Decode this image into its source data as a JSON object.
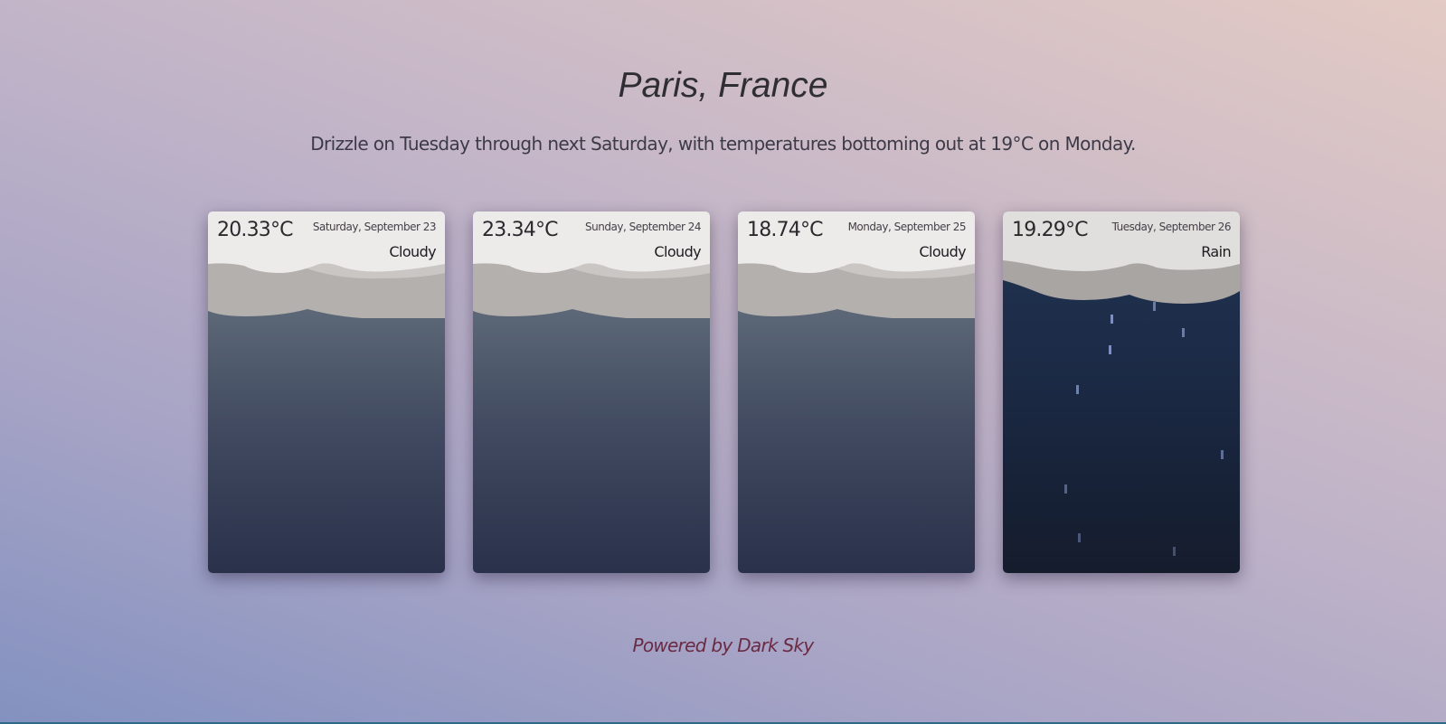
{
  "location": {
    "title": "Paris, France"
  },
  "summary": "Drizzle on Tuesday through next Saturday, with temperatures bottoming out at 19°C on Monday.",
  "forecast": [
    {
      "temperature": "20.33°C",
      "date": "Saturday, September 23",
      "condition": "Cloudy",
      "icon": "cloudy-scene"
    },
    {
      "temperature": "23.34°C",
      "date": "Sunday, September 24",
      "condition": "Cloudy",
      "icon": "cloudy-scene"
    },
    {
      "temperature": "18.74°C",
      "date": "Monday, September 25",
      "condition": "Cloudy",
      "icon": "cloudy-scene"
    },
    {
      "temperature": "19.29°C",
      "date": "Tuesday, September 26",
      "condition": "Rain",
      "icon": "rain-scene"
    }
  ],
  "footer": {
    "powered_by": "Powered by Dark Sky"
  },
  "colors": {
    "cloudy_sky_top": "#6e7a86",
    "cloudy_sky_bottom": "#2a314b",
    "rain_sky_top": "#223551",
    "rain_sky_bottom": "#151c2c",
    "raindrop": "#7d8fbf",
    "link": "#6b2a44"
  }
}
